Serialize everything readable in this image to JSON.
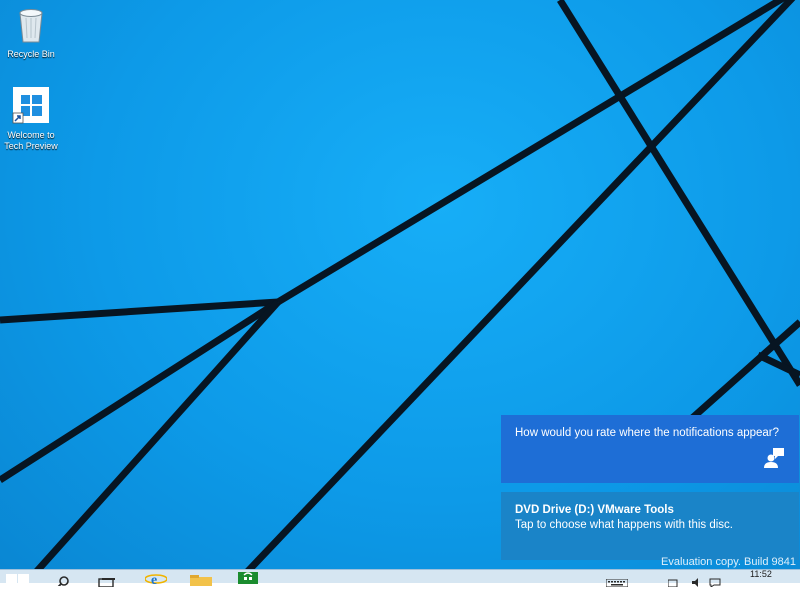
{
  "desktop": {
    "icons": [
      {
        "label": "Recycle Bin",
        "icon": "recycle-bin-icon"
      },
      {
        "label": "Welcome to\nTech Preview",
        "icon": "windows-logo-icon"
      }
    ]
  },
  "notifications": [
    {
      "title": "",
      "body": "How would you rate where the notifications appear?",
      "icon": "feedback-icon",
      "bg_color": "#1e6ed6"
    },
    {
      "title": "DVD Drive (D:) VMware Tools",
      "body": "Tap to choose what happens with this disc.",
      "bg_color": "#1a84c8"
    }
  ],
  "watermark": "Evaluation copy. Build 9841",
  "taskbar": {
    "items": [
      "start-button",
      "search-icon",
      "task-view-icon",
      "internet-explorer-icon",
      "file-explorer-icon",
      "store-icon"
    ],
    "tray": [
      "touch-keyboard-icon",
      "network-icon",
      "volume-icon",
      "action-center-icon"
    ],
    "clock": "11:52"
  },
  "colors": {
    "wallpaper": "#0d9ae8",
    "wallpaper_lines": "#0a1a2a",
    "taskbar": "#d6e6f2"
  }
}
